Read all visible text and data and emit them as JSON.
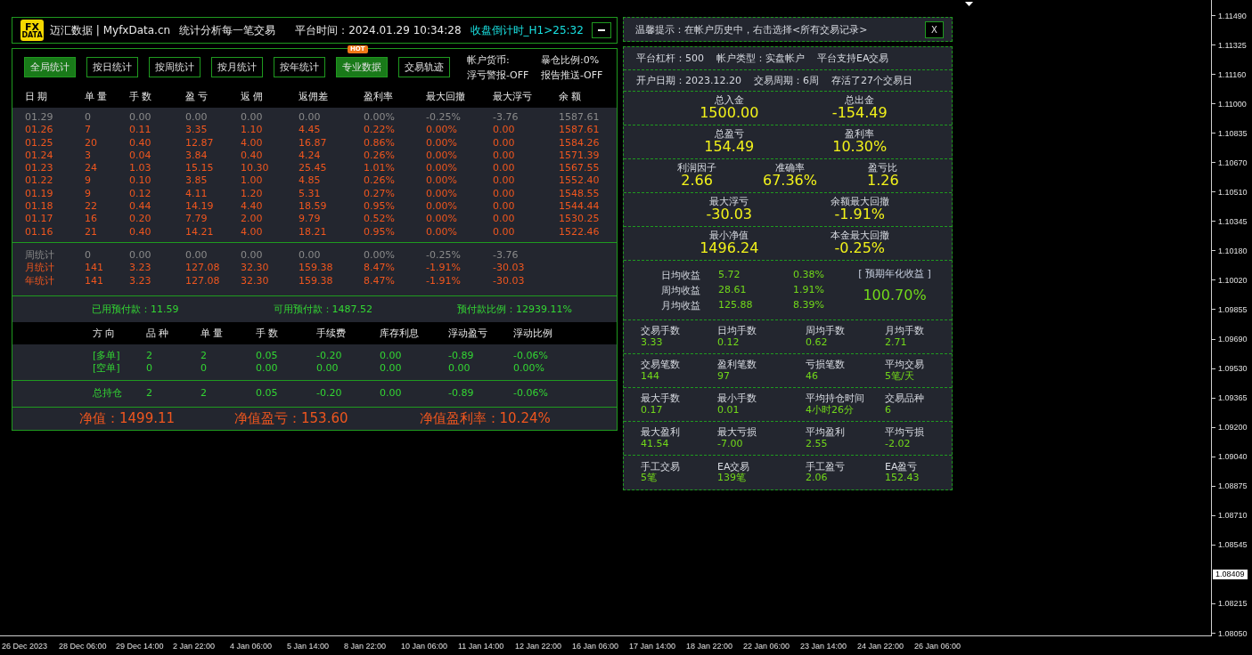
{
  "header": {
    "logo": [
      "FX",
      "DATA"
    ],
    "brand": "迈汇数据 | MyfxData.cn",
    "slogan": "统计分析每一笔交易",
    "platform_time": "平台时间：2024.01.29 10:34:28",
    "countdown": "收盘倒计时_H1>25:32"
  },
  "tabs": [
    {
      "label": "全局统计",
      "selected": true
    },
    {
      "label": "按日统计",
      "selected": false
    },
    {
      "label": "按周统计",
      "selected": false
    },
    {
      "label": "按月统计",
      "selected": false
    },
    {
      "label": "按年统计",
      "selected": false
    },
    {
      "label": "专业数据",
      "selected": true,
      "badge": "HOT"
    },
    {
      "label": "交易轨迹",
      "selected": false
    }
  ],
  "account_flags": [
    "帐户货币:",
    "暴仓比例:0%",
    "浮亏警报-OFF",
    "报告推送-OFF"
  ],
  "daily_table": {
    "columns": [
      "日 期",
      "单 量",
      "手 数",
      "盈 亏",
      "返 佣",
      "返佣差",
      "盈利率",
      "最大回撤",
      "最大浮亏",
      "余 额"
    ],
    "rows": [
      {
        "kind": "current",
        "cells": [
          "01.29",
          "0",
          "0.00",
          "0.00",
          "0.00",
          "0.00",
          "0.00%",
          "-0.25%",
          "-3.76",
          "1587.61"
        ]
      },
      {
        "kind": "closed",
        "cells": [
          "01.26",
          "7",
          "0.11",
          "3.35",
          "1.10",
          "4.45",
          "0.22%",
          "0.00%",
          "0.00",
          "1587.61"
        ]
      },
      {
        "kind": "closed",
        "cells": [
          "01.25",
          "20",
          "0.40",
          "12.87",
          "4.00",
          "16.87",
          "0.86%",
          "0.00%",
          "0.00",
          "1584.26"
        ]
      },
      {
        "kind": "closed",
        "cells": [
          "01.24",
          "3",
          "0.04",
          "3.84",
          "0.40",
          "4.24",
          "0.26%",
          "0.00%",
          "0.00",
          "1571.39"
        ]
      },
      {
        "kind": "closed",
        "cells": [
          "01.23",
          "24",
          "1.03",
          "15.15",
          "10.30",
          "25.45",
          "1.01%",
          "0.00%",
          "0.00",
          "1567.55"
        ]
      },
      {
        "kind": "closed",
        "cells": [
          "01.22",
          "9",
          "0.10",
          "3.85",
          "1.00",
          "4.85",
          "0.26%",
          "0.00%",
          "0.00",
          "1552.40"
        ]
      },
      {
        "kind": "closed",
        "cells": [
          "01.19",
          "9",
          "0.12",
          "4.11",
          "1.20",
          "5.31",
          "0.27%",
          "0.00%",
          "0.00",
          "1548.55"
        ]
      },
      {
        "kind": "closed",
        "cells": [
          "01.18",
          "22",
          "0.44",
          "14.19",
          "4.40",
          "18.59",
          "0.95%",
          "0.00%",
          "0.00",
          "1544.44"
        ]
      },
      {
        "kind": "closed",
        "cells": [
          "01.17",
          "16",
          "0.20",
          "7.79",
          "2.00",
          "9.79",
          "0.52%",
          "0.00%",
          "0.00",
          "1530.25"
        ]
      },
      {
        "kind": "closed",
        "cells": [
          "01.16",
          "21",
          "0.40",
          "14.21",
          "4.00",
          "18.21",
          "0.95%",
          "0.00%",
          "0.00",
          "1522.46"
        ]
      }
    ]
  },
  "summary_rows": [
    {
      "kind": "current",
      "cells": [
        "周统计",
        "0",
        "0.00",
        "0.00",
        "0.00",
        "0.00",
        "0.00%",
        "-0.25%",
        "-3.76"
      ]
    },
    {
      "kind": "closed",
      "cells": [
        "月统计",
        "141",
        "3.23",
        "127.08",
        "32.30",
        "159.38",
        "8.47%",
        "-1.91%",
        "-30.03"
      ]
    },
    {
      "kind": "closed",
      "cells": [
        "年统计",
        "141",
        "3.23",
        "127.08",
        "32.30",
        "159.38",
        "8.47%",
        "-1.91%",
        "-30.03"
      ]
    }
  ],
  "prepayment": [
    "已用预付款：11.59",
    "可用预付款：1487.52",
    "预付款比例：12939.11%"
  ],
  "positions": {
    "columns": [
      "方 向",
      "品 种",
      "单 量",
      "手 数",
      "手续费",
      "库存利息",
      "浮动盈亏",
      "浮动比例"
    ],
    "rows": [
      [
        "[多单]",
        "2",
        "2",
        "0.05",
        "-0.20",
        "0.00",
        "-0.89",
        "-0.06%"
      ],
      [
        "[空单]",
        "0",
        "0",
        "0.00",
        "0.00",
        "0.00",
        "0.00",
        "0.00%"
      ]
    ],
    "total": [
      "总持仓",
      "2",
      "2",
      "0.05",
      "-0.20",
      "0.00",
      "-0.89",
      "-0.06%"
    ]
  },
  "equity": [
    "净值：1499.11",
    "净值盈亏：153.60",
    "净值盈利率：10.24%"
  ],
  "tip": {
    "text": "温馨提示：在帐户历史中，右击选择<所有交易记录>",
    "close": "X"
  },
  "account_info": [
    [
      "平台杠杆：500",
      "帐户类型：实盘帐户",
      "平台支持EA交易"
    ],
    [
      "开户日期：2023.12.20",
      "交易周期：6周",
      "存活了27个交易日"
    ]
  ],
  "key_stats": [
    [
      {
        "label": "总入金",
        "value": "1500.00"
      },
      {
        "label": "总出金",
        "value": "-154.49"
      }
    ],
    [
      {
        "label": "总盈亏",
        "value": "154.49"
      },
      {
        "label": "盈利率",
        "value": "10.30%"
      }
    ],
    [
      {
        "label": "利润因子",
        "value": "2.66"
      },
      {
        "label": "准确率",
        "value": "67.36%"
      },
      {
        "label": "盈亏比",
        "value": "1.26"
      }
    ],
    [
      {
        "label": "最大浮亏",
        "value": "-30.03"
      },
      {
        "label": "余额最大回撤",
        "value": "-1.91%"
      }
    ],
    [
      {
        "label": "最小净值",
        "value": "1496.24"
      },
      {
        "label": "本金最大回撤",
        "value": "-0.25%"
      }
    ]
  ],
  "averages": {
    "rows": [
      {
        "label": "日均收益",
        "value": "5.72",
        "percent": "0.38%"
      },
      {
        "label": "周均收益",
        "value": "28.61",
        "percent": "1.91%"
      },
      {
        "label": "月均收益",
        "value": "125.88",
        "percent": "8.39%"
      }
    ],
    "annual_label": "[ 预期年化收益 ]",
    "annual_value": "100.70%"
  },
  "stat_grid": [
    [
      {
        "label": "交易手数",
        "value": "3.33"
      },
      {
        "label": "日均手数",
        "value": "0.12"
      },
      {
        "label": "周均手数",
        "value": "0.62"
      },
      {
        "label": "月均手数",
        "value": "2.71"
      }
    ],
    [
      {
        "label": "交易笔数",
        "value": "144"
      },
      {
        "label": "盈利笔数",
        "value": "97"
      },
      {
        "label": "亏损笔数",
        "value": "46"
      },
      {
        "label": "平均交易",
        "value": "5笔/天"
      }
    ],
    [
      {
        "label": "最大手数",
        "value": "0.17"
      },
      {
        "label": "最小手数",
        "value": "0.01"
      },
      {
        "label": "平均持仓时间",
        "value": "4小时26分"
      },
      {
        "label": "交易品种",
        "value": "6"
      }
    ],
    [
      {
        "label": "最大盈利",
        "value": "41.54"
      },
      {
        "label": "最大亏损",
        "value": "-7.00"
      },
      {
        "label": "平均盈利",
        "value": "2.55"
      },
      {
        "label": "平均亏损",
        "value": "-2.02"
      }
    ],
    [
      {
        "label": "手工交易",
        "value": "5笔"
      },
      {
        "label": "EA交易",
        "value": "139笔"
      },
      {
        "label": "手工盈亏",
        "value": "2.06"
      },
      {
        "label": "EA盈亏",
        "value": "152.43"
      }
    ]
  ],
  "price_axis": [
    {
      "kind": "tick",
      "text": "1.11490"
    },
    {
      "kind": "tick",
      "text": "1.11325"
    },
    {
      "kind": "tick",
      "text": "1.11160"
    },
    {
      "kind": "tick",
      "text": "1.11000"
    },
    {
      "kind": "tick",
      "text": "1.10835"
    },
    {
      "kind": "tick",
      "text": "1.10670"
    },
    {
      "kind": "tick",
      "text": "1.10510"
    },
    {
      "kind": "tick",
      "text": "1.10345"
    },
    {
      "kind": "tick",
      "text": "1.10180"
    },
    {
      "kind": "tick",
      "text": "1.10020"
    },
    {
      "kind": "tick",
      "text": "1.09855"
    },
    {
      "kind": "tick",
      "text": "1.09690"
    },
    {
      "kind": "tick",
      "text": "1.09530"
    },
    {
      "kind": "tick",
      "text": "1.09365"
    },
    {
      "kind": "tick",
      "text": "1.09200"
    },
    {
      "kind": "tick",
      "text": "1.09040"
    },
    {
      "kind": "tick",
      "text": "1.08875"
    },
    {
      "kind": "tick",
      "text": "1.08710"
    },
    {
      "kind": "tick",
      "text": "1.08545"
    },
    {
      "kind": "current",
      "text": "1.08409"
    },
    {
      "kind": "tick",
      "text": "1.08215"
    },
    {
      "kind": "tick",
      "text": "1.08050"
    }
  ],
  "time_axis": [
    "26 Dec 2023",
    "28 Dec 06:00",
    "29 Dec 14:00",
    "2 Jan 22:00",
    "4 Jan 06:00",
    "5 Jan 14:00",
    "8 Jan 22:00",
    "10 Jan 06:00",
    "11 Jan 14:00",
    "12 Jan 22:00",
    "16 Jan 06:00",
    "17 Jan 14:00",
    "18 Jan 22:00",
    "22 Jan 06:00",
    "23 Jan 14:00",
    "24 Jan 22:00",
    "26 Jan 06:00"
  ]
}
